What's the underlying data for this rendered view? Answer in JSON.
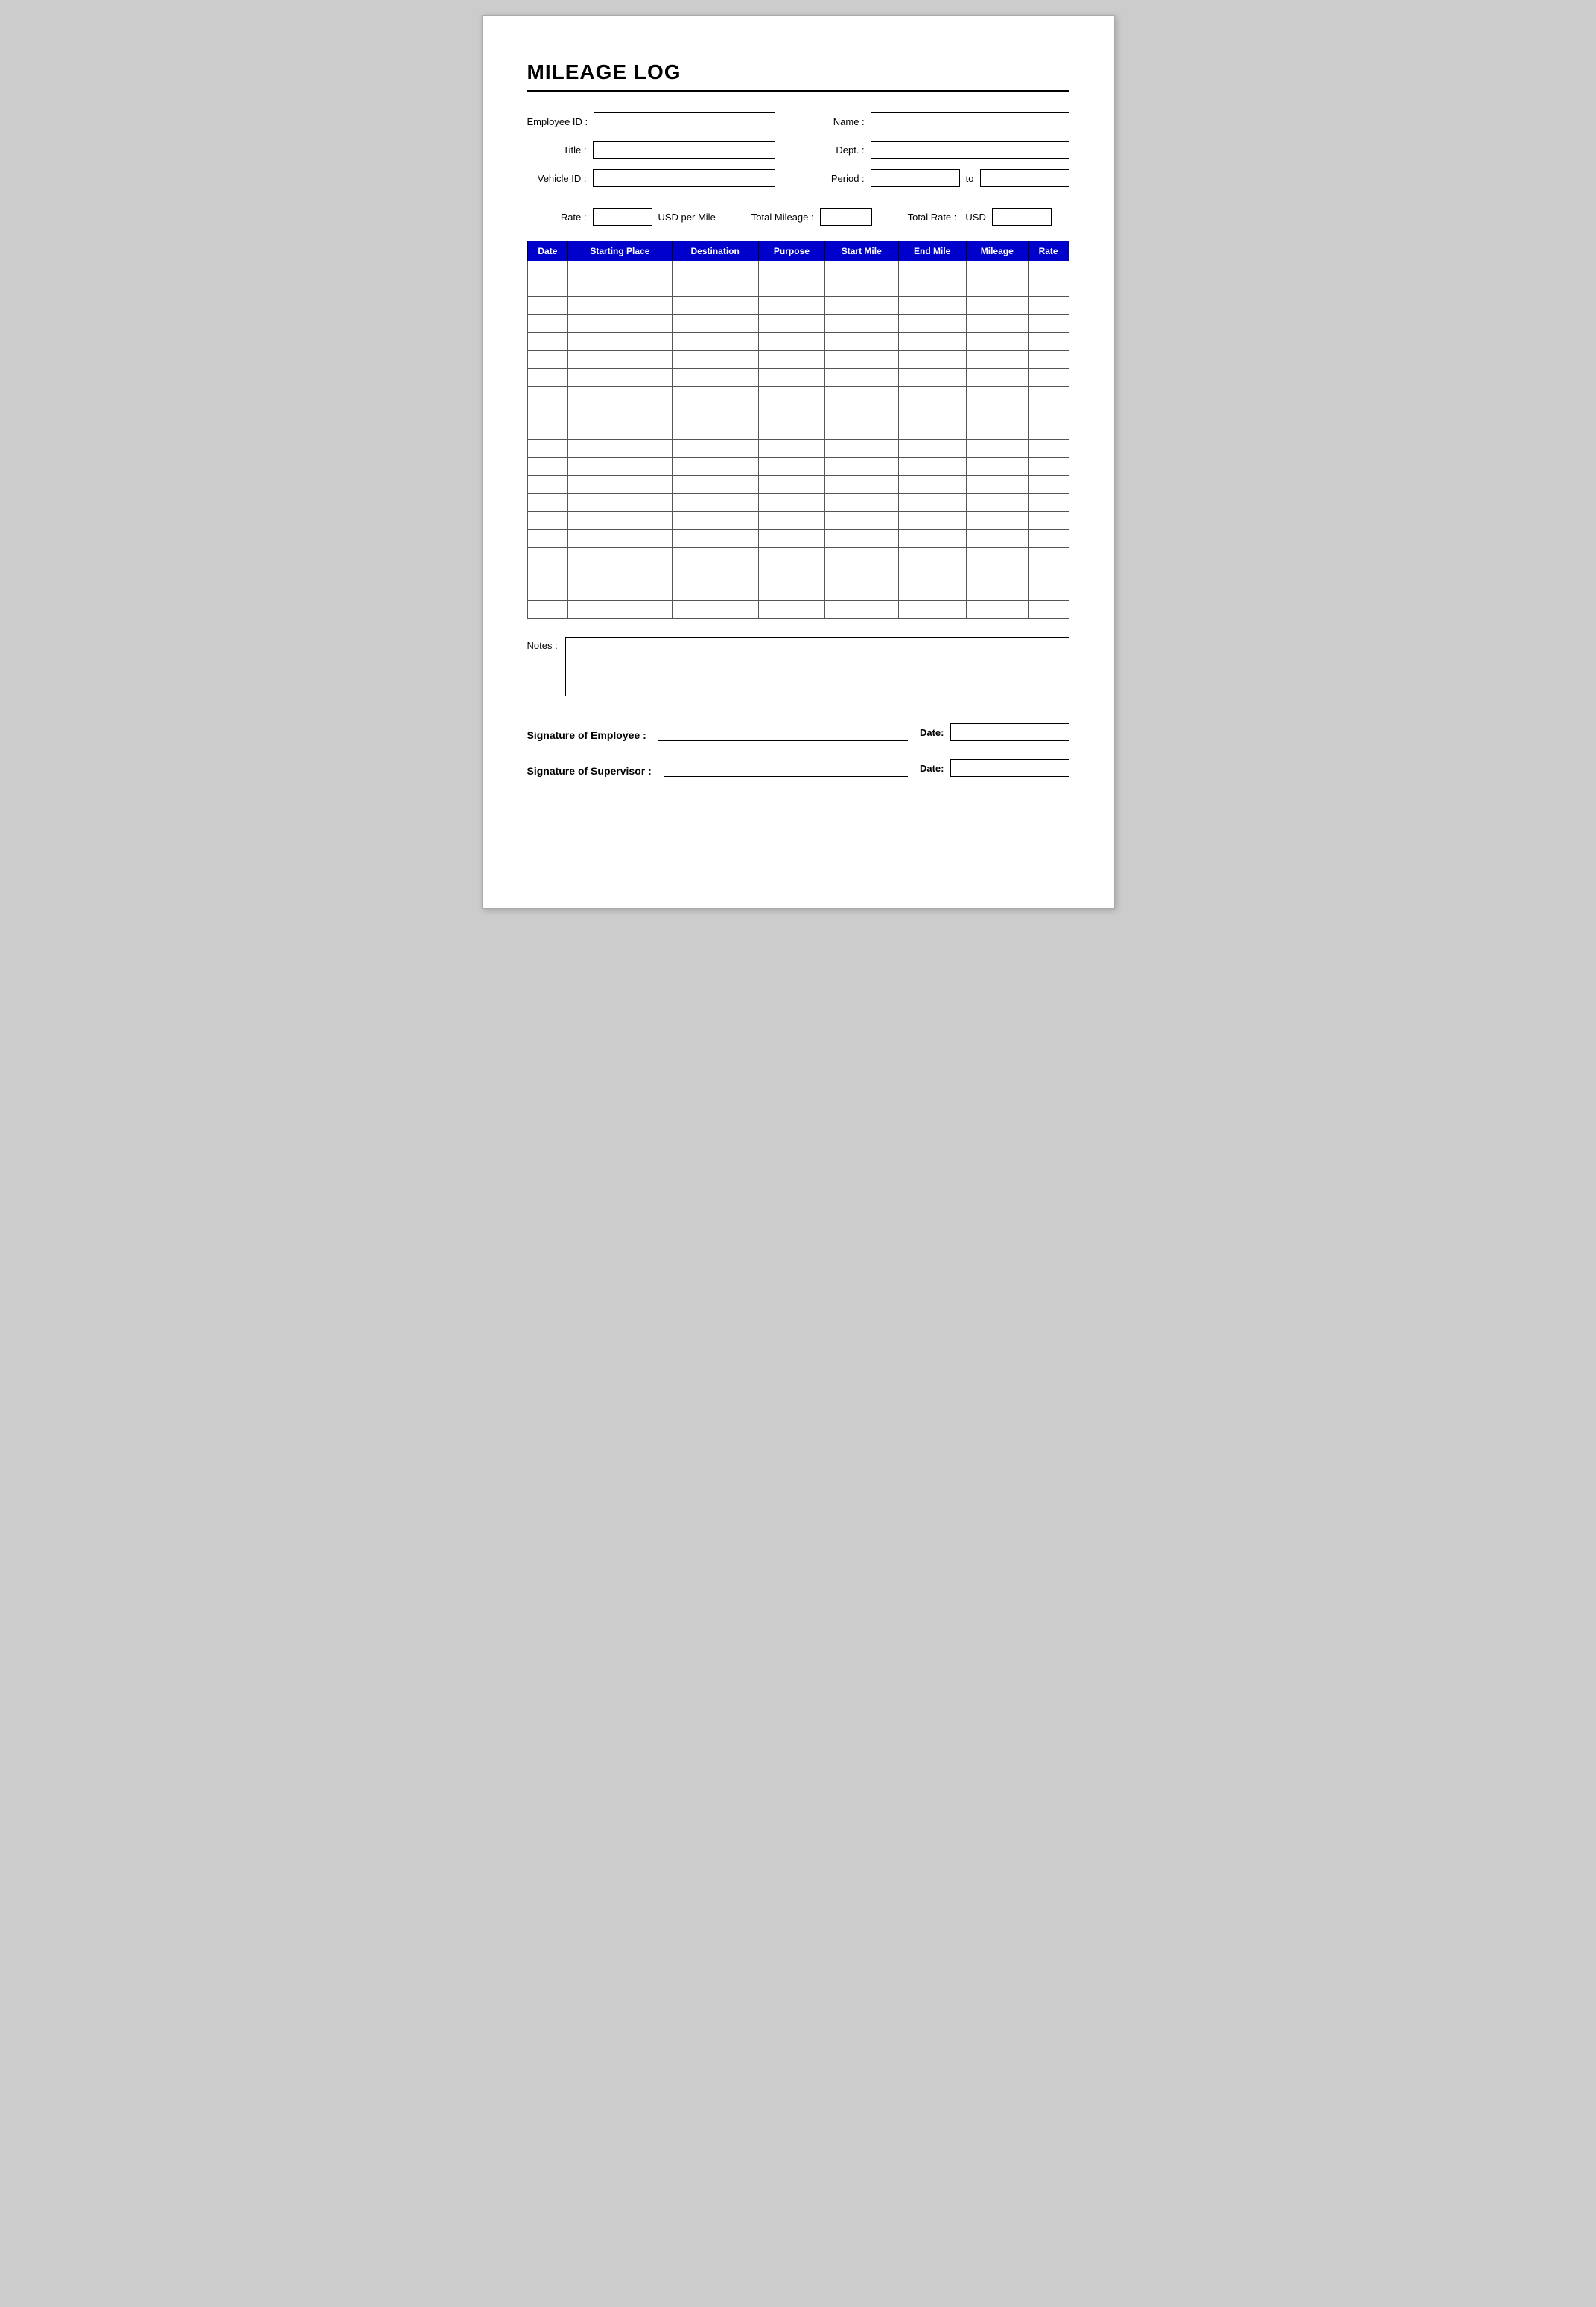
{
  "title": "MILEAGE LOG",
  "form": {
    "employee_id_label": "Employee ID :",
    "name_label": "Name :",
    "title_label": "Title :",
    "dept_label": "Dept. :",
    "vehicle_id_label": "Vehicle ID :",
    "period_label": "Period :",
    "period_to": "to",
    "rate_label": "Rate :",
    "usd_per_mile": "USD per Mile",
    "total_mileage_label": "Total Mileage :",
    "total_rate_label": "Total Rate :",
    "total_rate_usd": "USD"
  },
  "table": {
    "headers": [
      "Date",
      "Starting Place",
      "Destination",
      "Purpose",
      "Start Mile",
      "End Mile",
      "Mileage",
      "Rate"
    ],
    "row_count": 20
  },
  "notes": {
    "label": "Notes :"
  },
  "signatures": {
    "employee_label": "Signature of Employee :",
    "supervisor_label": "Signature of Supervisor :",
    "date_label": "Date:"
  }
}
